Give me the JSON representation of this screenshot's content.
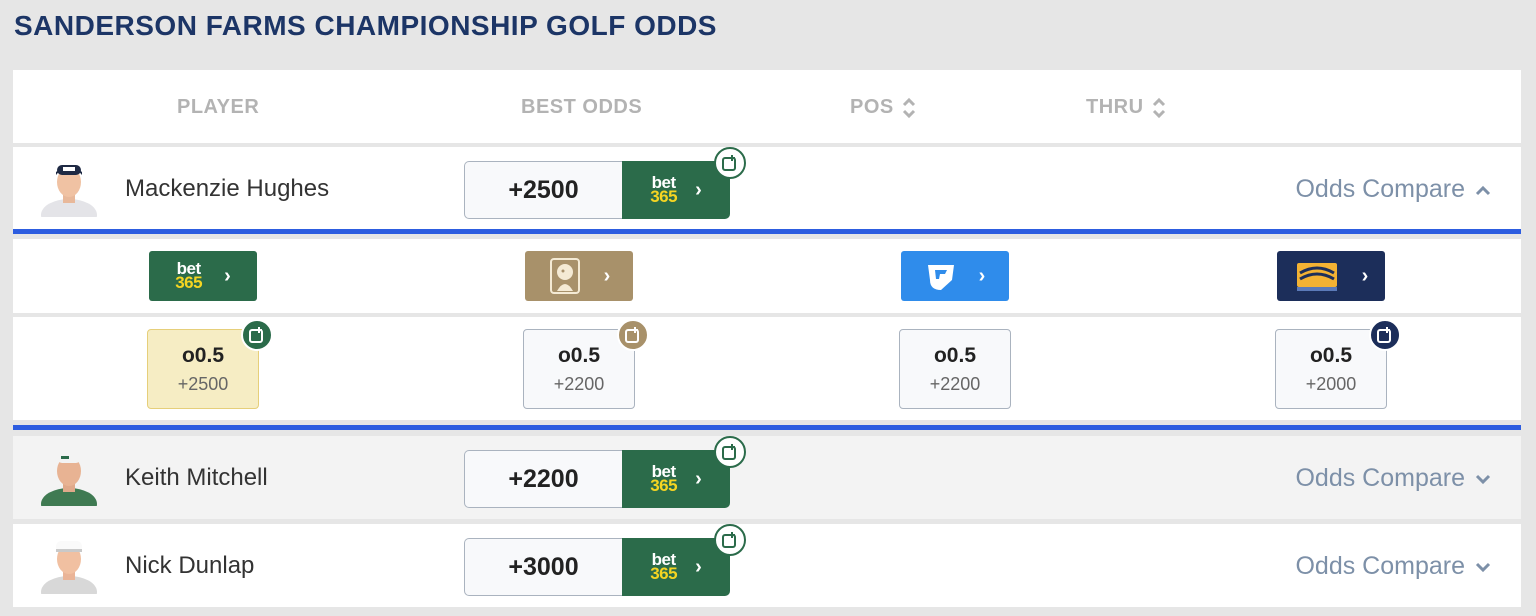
{
  "title": "SANDERSON FARMS CHAMPIONSHIP GOLF ODDS",
  "columns": {
    "player": "PLAYER",
    "best_odds": "BEST ODDS",
    "pos": "POS",
    "thru": "THRU"
  },
  "odds_compare_label": "Odds Compare",
  "players": [
    {
      "name": "Mackenzie Hughes",
      "best_odds": "+2500",
      "book": "bet365",
      "expanded": true
    },
    {
      "name": "Keith Mitchell",
      "best_odds": "+2200",
      "book": "bet365",
      "expanded": false
    },
    {
      "name": "Nick Dunlap",
      "best_odds": "+3000",
      "book": "bet365",
      "expanded": false
    }
  ],
  "expanded": {
    "books": [
      {
        "name": "bet365",
        "line": "o0.5",
        "odds": "+2500",
        "is_best": true
      },
      {
        "name": "BetMGM",
        "line": "o0.5",
        "odds": "+2200",
        "is_best": false
      },
      {
        "name": "FanDuel",
        "line": "o0.5",
        "odds": "+2200",
        "is_best": false
      },
      {
        "name": "BetRivers",
        "line": "o0.5",
        "odds": "+2000",
        "is_best": false
      }
    ]
  },
  "bet365_logo": {
    "line1": "bet",
    "line2": "365"
  },
  "colors": {
    "title": "#1c3566",
    "bet365": "#2b6b4a",
    "betmgm": "#a8916a",
    "fanduel": "#2f8ceb",
    "betrivers": "#1c2e5a",
    "accent_divider": "#2d5de0",
    "best_highlight": "#f6edc4"
  }
}
